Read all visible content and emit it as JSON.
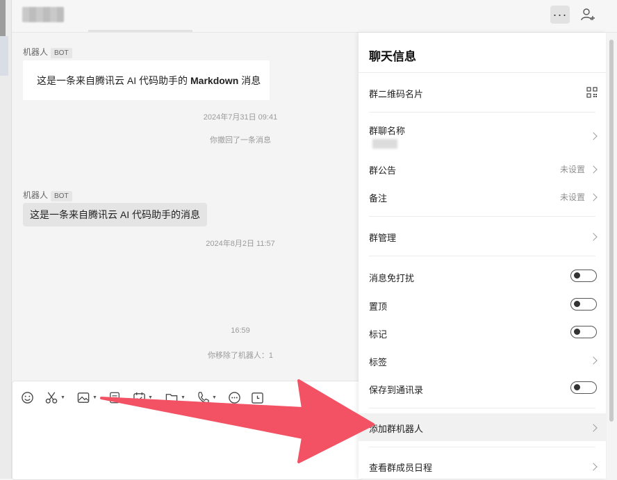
{
  "chat": {
    "messages": [
      {
        "sender": "机器人",
        "badge": "BOT",
        "text_before": "这是一条来自腾讯云 AI 代码助手的",
        "text_bold": "Markdown",
        "text_after": "消息"
      },
      {
        "sender": "机器人",
        "badge": "BOT",
        "text": "这是一条来自腾讯云 AI 代码助手的消息"
      }
    ],
    "system": {
      "ts1": "2024年7月31日 09:41",
      "recall": "你撤回了一条消息",
      "ts2": "2024年8月2日 11:57",
      "ts3": "16:59",
      "removed": "你移除了机器人：1"
    }
  },
  "toolbar_icons": [
    "emoji-icon",
    "scissors-icon",
    "image-icon",
    "document-icon",
    "calendar-check-icon",
    "folder-icon",
    "phone-icon",
    "chat-bubble-icon",
    "clock-icon"
  ],
  "panel": {
    "title": "聊天信息",
    "qr_label": "群二维码名片",
    "group_name_label": "群聊名称",
    "announcement_label": "群公告",
    "announcement_value": "未设置",
    "remark_label": "备注",
    "remark_value": "未设置",
    "manage_label": "群管理",
    "mute_label": "消息免打扰",
    "pin_label": "置顶",
    "mark_label": "标记",
    "tag_label": "标签",
    "save_label": "保存到通讯录",
    "add_bot_label": "添加群机器人",
    "schedule_label": "查看群成员日程"
  },
  "colors": {
    "annotation_arrow": "#f25263",
    "panel_bg": "#ffffff",
    "chat_bg": "#f4f4f4"
  }
}
